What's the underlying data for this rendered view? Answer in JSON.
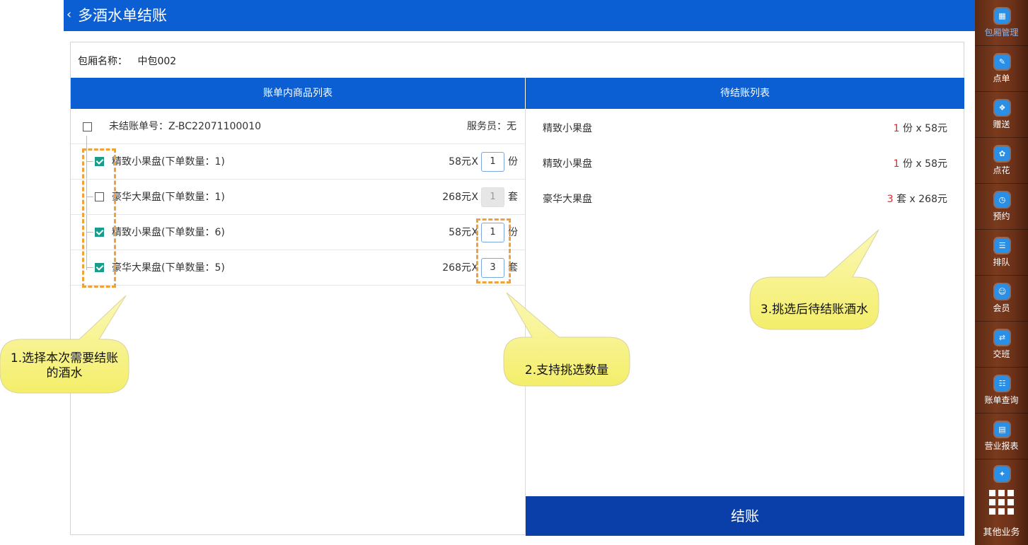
{
  "header": {
    "back_icon": "‹",
    "title": "多酒水单结账"
  },
  "room": {
    "label": "包厢名称：",
    "value": "中包002"
  },
  "left_panel": {
    "title": "账单内商品列表",
    "bill_label": "未结账单号：Z-BC22071100010",
    "waiter_label": "服务员：无",
    "items": [
      {
        "name": "精致小果盘(下单数量：1)",
        "price": "58元",
        "x": "X",
        "qty": "1",
        "unit": "份",
        "checked": true,
        "disabled": false
      },
      {
        "name": "豪华大果盘(下单数量：1)",
        "price": "268元",
        "x": "X",
        "qty": "1",
        "unit": "套",
        "checked": false,
        "disabled": true
      },
      {
        "name": "精致小果盘(下单数量：6)",
        "price": "58元",
        "x": "X",
        "qty": "1",
        "unit": "份",
        "checked": true,
        "disabled": false
      },
      {
        "name": "豪华大果盘(下单数量：5)",
        "price": "268元",
        "x": "X",
        "qty": "3",
        "unit": "套",
        "checked": true,
        "disabled": false
      }
    ]
  },
  "right_panel": {
    "title": "待结账列表",
    "items": [
      {
        "name": "精致小果盘",
        "count": "1",
        "rest": " 份 x 58元"
      },
      {
        "name": "精致小果盘",
        "count": "1",
        "rest": " 份 x 58元"
      },
      {
        "name": "豪华大果盘",
        "count": "3",
        "rest": " 套 x 268元"
      }
    ],
    "checkout_label": "结账"
  },
  "sidebar": {
    "items": [
      {
        "label": "包厢管理",
        "icon": "room-icon",
        "glyph": "▦"
      },
      {
        "label": "点单",
        "icon": "order-icon",
        "glyph": "✎"
      },
      {
        "label": "赠送",
        "icon": "gift-icon",
        "glyph": "❖"
      },
      {
        "label": "点花",
        "icon": "flower-icon",
        "glyph": "✿"
      },
      {
        "label": "预约",
        "icon": "booking-icon",
        "glyph": "◷"
      },
      {
        "label": "排队",
        "icon": "queue-icon",
        "glyph": "☰"
      },
      {
        "label": "会员",
        "icon": "member-icon",
        "glyph": "☺"
      },
      {
        "label": "交班",
        "icon": "shift-icon",
        "glyph": "⇄"
      },
      {
        "label": "账单查询",
        "icon": "bill-query-icon",
        "glyph": "☷"
      },
      {
        "label": "营业报表",
        "icon": "report-icon",
        "glyph": "▤"
      },
      {
        "label": "",
        "icon": "more-icon",
        "glyph": "✦"
      }
    ],
    "other_label": "其他业务"
  },
  "annotations": {
    "a1_line1": "1.选择本次需要结账",
    "a1_line2": "的酒水",
    "a2": "2.支持挑选数量",
    "a3": "3.挑选后待结账酒水"
  },
  "colors": {
    "primary": "#0b5fd3",
    "checkout": "#0a3ea8",
    "checked": "#1a9c8c",
    "count_red": "#e3262b",
    "annotation": "#f0a23a"
  }
}
